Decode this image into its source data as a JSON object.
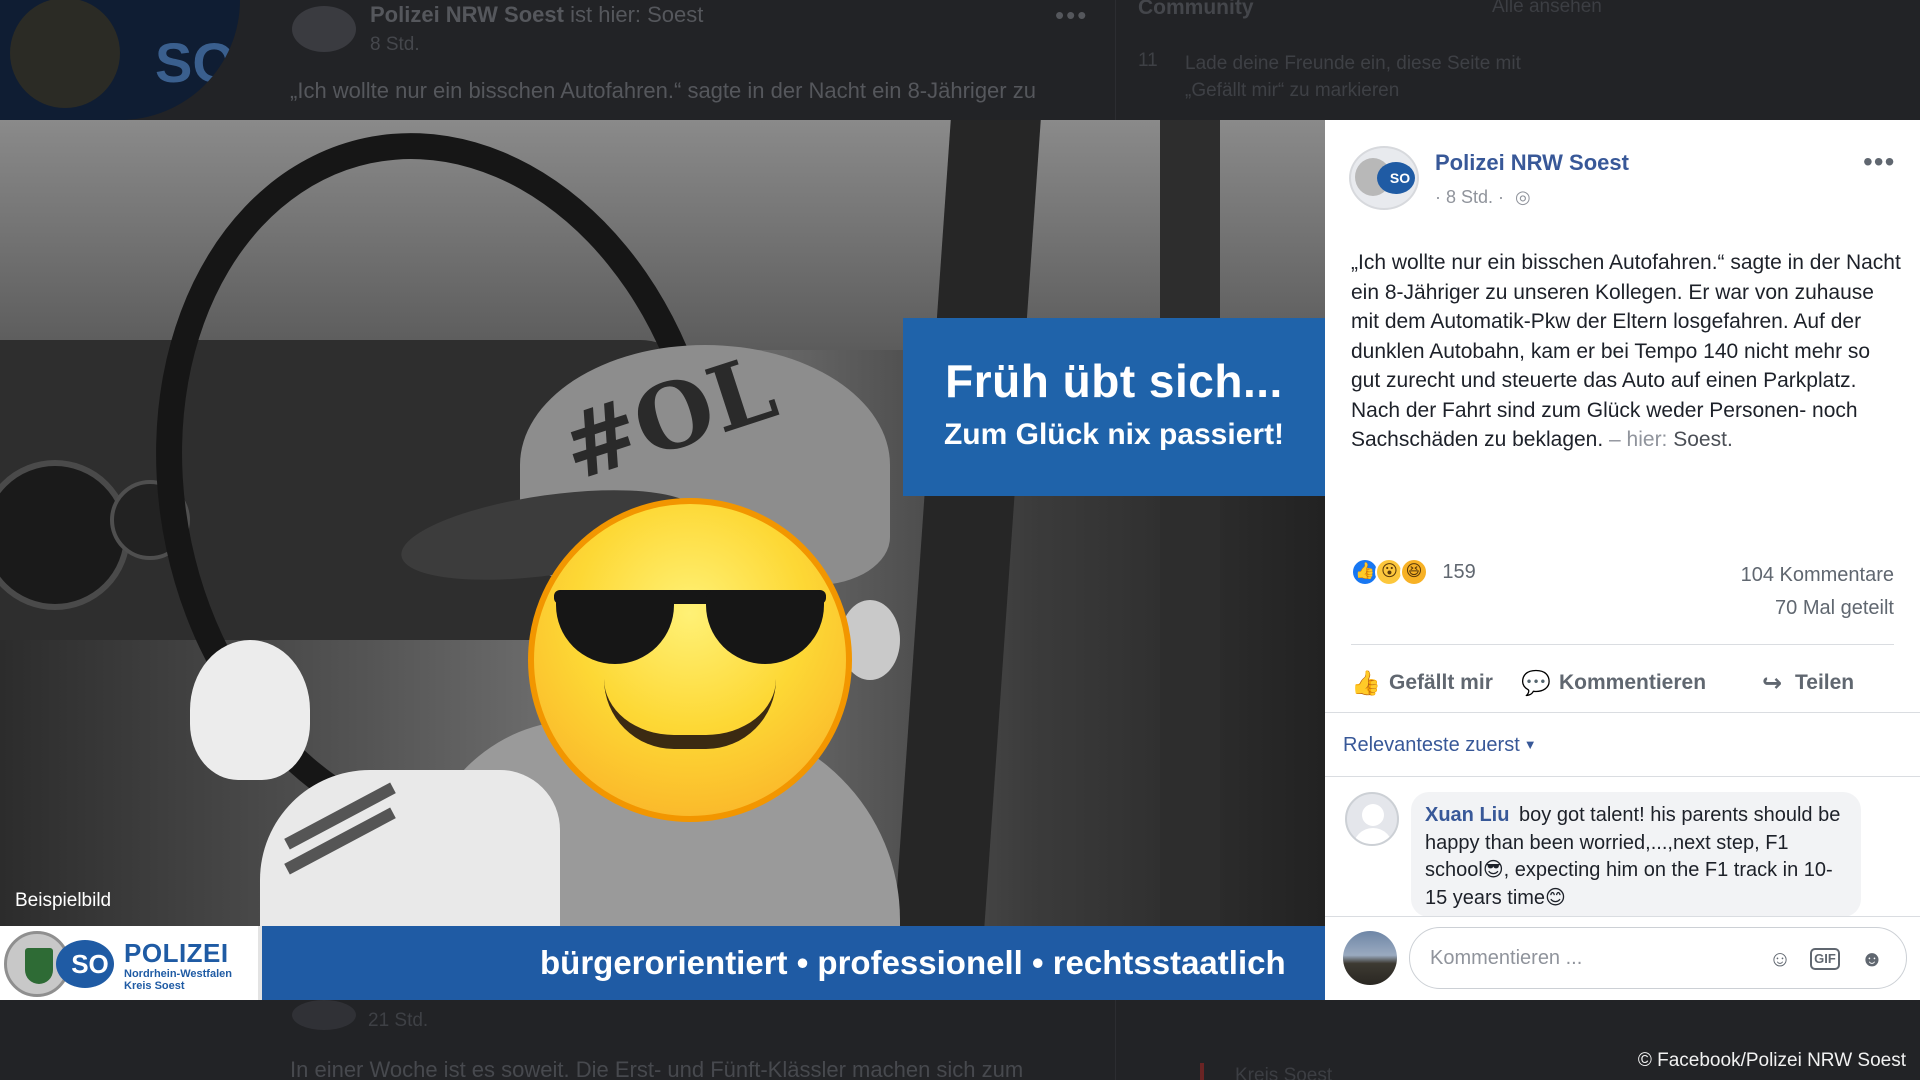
{
  "background": {
    "post_name": "Polizei NRW Soest",
    "post_name_suffix": "ist hier: Soest",
    "post_time": "8 Std.",
    "post_quote": "„Ich wollte nur ein bisschen Autofahren.“ sagte in der Nacht ein 8-Jähriger zu",
    "right_header": "Community",
    "right_link": "Alle ansehen",
    "right_num": "11",
    "right_text": "Lade deine Freunde ein, diese Seite mit „Gefällt mir“ zu markieren",
    "logo_so": "SO",
    "lower_time": "21 Std.",
    "lower_teaser": "In einer Woche ist es soweit. Die Erst- und Fünft-Klässler machen sich zum",
    "lower_right": "Kreis Soest"
  },
  "credit": "© Facebook/Polizei NRW Soest",
  "photo": {
    "banner_title": "Früh übt sich...",
    "banner_subtitle": "Zum Glück nix passiert!",
    "caption": "Beispielbild",
    "cap_logo": "#OL",
    "footer": {
      "brand": "POLIZEI",
      "brand_sub1": "Nordrhein-Westfalen",
      "brand_sub2": "Kreis Soest",
      "badge": "SO",
      "slogan": "bürgerorientiert • professionell • rechtsstaatlich"
    }
  },
  "panel": {
    "page_name": "Polizei NRW Soest",
    "avatar_badge": "SO",
    "time": "· 8 Std. ·",
    "more_icon": "•••",
    "globe_icon": "◎",
    "post_text": "„Ich wollte nur ein bisschen Autofahren.“ sagte in der Nacht ein 8-Jähriger zu unseren Kollegen. Er war von zuhause mit dem Automatik-Pkw der Eltern losgefahren. Auf der dunklen Autobahn, kam er bei Tempo 140 nicht mehr so gut zurecht und steuerte das Auto auf einen Parkplatz. Nach der Fahrt sind zum Glück weder Personen- noch Sachschäden zu beklagen.",
    "post_sep": "– hier:",
    "post_location": "Soest.",
    "reactions": {
      "like_icon": "👍",
      "wow_icon": "😮",
      "haha_icon": "😆",
      "count": "159",
      "comments": "104 Kommentare",
      "shares": "70 Mal geteilt"
    },
    "actions": {
      "like_icon": "👍",
      "like": "Gefällt mir",
      "comment_icon": "💬",
      "comment": "Kommentieren",
      "share_icon": "↪",
      "share": "Teilen"
    },
    "sort_label": "Relevanteste zuerst",
    "sort_caret": "▼",
    "comment": {
      "author": "Xuan Liu",
      "text": "boy got talent! his parents should be happy than been worried,...,next step, F1 school😎, expecting him on the F1 track in 10-15 years time😊"
    },
    "composer": {
      "placeholder": "Kommentieren ...",
      "emoji_icon": "☺",
      "gif_icon": "GIF",
      "sticker_icon": "☻"
    }
  },
  "colors": {
    "facebook_blue": "#385898",
    "police_blue": "#1f5ba4",
    "banner_blue": "#1f63aa",
    "emoji_yellow": "#fdd835"
  }
}
